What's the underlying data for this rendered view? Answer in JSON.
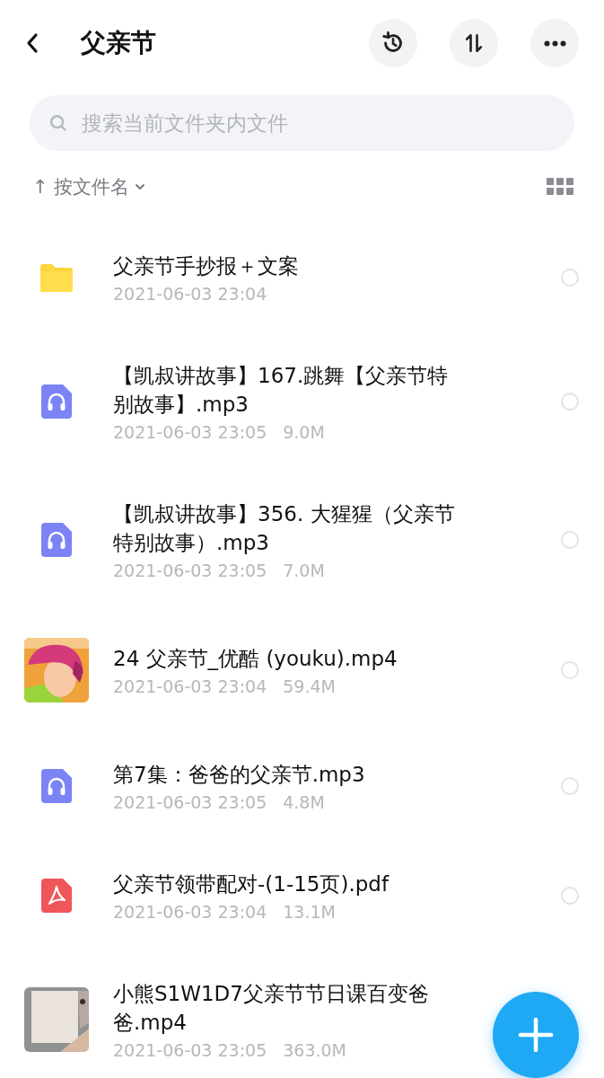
{
  "header": {
    "title": "父亲节"
  },
  "search": {
    "placeholder": "搜索当前文件夹内文件"
  },
  "sort": {
    "arrow": "↑",
    "label": "按文件名"
  },
  "files": [
    {
      "kind": "folder",
      "name": "父亲节手抄报＋文案",
      "date": "2021-06-03 23:04",
      "selected": false
    },
    {
      "kind": "audio",
      "name": "【凯叔讲故事】167.跳舞【父亲节特别故事】.mp3",
      "date": "2021-06-03 23:05",
      "size": "9.0M",
      "selected": false
    },
    {
      "kind": "audio",
      "name": "【凯叔讲故事】356. 大猩猩（父亲节特别故事）.mp3",
      "date": "2021-06-03 23:05",
      "size": "7.0M",
      "selected": false
    },
    {
      "kind": "video",
      "name": "24 父亲节_优酷 (youku).mp4",
      "date": "2021-06-03 23:04",
      "size": "59.4M",
      "selected": false
    },
    {
      "kind": "audio",
      "name": "第7集：爸爸的父亲节.mp3",
      "date": "2021-06-03 23:05",
      "size": "4.8M",
      "selected": false
    },
    {
      "kind": "pdf",
      "name": "父亲节领带配对-(1-15页).pdf",
      "date": "2021-06-03 23:04",
      "size": "13.1M",
      "selected": false
    },
    {
      "kind": "video2",
      "name": "小熊S1W1D7父亲节节日课百变爸爸.mp4",
      "date": "2021-06-03 23:05",
      "size": "363.0M"
    }
  ]
}
